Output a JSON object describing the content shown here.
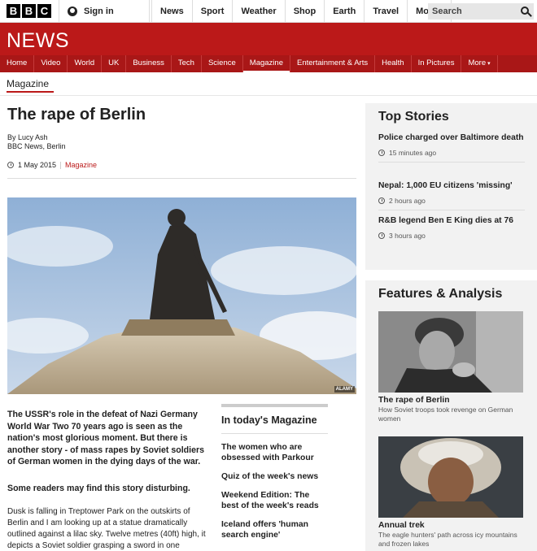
{
  "topbar": {
    "logo_letters": [
      "B",
      "B",
      "C"
    ],
    "signin_label": "Sign in",
    "nav": [
      "News",
      "Sport",
      "Weather",
      "Shop",
      "Earth",
      "Travel"
    ],
    "more_label": "More",
    "search_placeholder": "Search"
  },
  "banner": {
    "title": "NEWS"
  },
  "section_nav": {
    "items": [
      "Home",
      "Video",
      "World",
      "UK",
      "Business",
      "Tech",
      "Science",
      "Magazine",
      "Entertainment & Arts",
      "Health",
      "In Pictures"
    ],
    "more_label": "More",
    "active": "Magazine"
  },
  "section_label": "Magazine",
  "article": {
    "headline": "The rape of Berlin",
    "author": "By Lucy Ash",
    "location": "BBC News, Berlin",
    "date": "1 May 2015",
    "category": "Magazine",
    "image_credit": "ALAMY",
    "lede": "The USSR's role in the defeat of Nazi Germany World War Two 70 years ago is seen as the nation's most glorious moment. But there is another story - of mass rapes by Soviet soldiers of German women in the dying days of the war.",
    "warning": "Some readers may find this story disturbing.",
    "body": "Dusk is falling in Treptower Park on the outskirts of Berlin and I am looking up at a statue dramatically outlined against a lilac sky. Twelve metres (40ft) high, it depicts a Soviet soldier grasping a sword in one"
  },
  "todays_magazine": {
    "title": "In today's Magazine",
    "items": [
      "The women who are obsessed with Parkour",
      "Quiz of the week's news",
      "Weekend Edition: The best of the week's reads",
      "Iceland offers 'human search engine'"
    ]
  },
  "top_stories": {
    "title": "Top Stories",
    "items": [
      {
        "title": "Police charged over Baltimore death",
        "time": "15 minutes ago"
      },
      {
        "title": "Nepal: 1,000 EU citizens 'missing'",
        "time": "2 hours ago"
      },
      {
        "title": "R&B legend Ben E King dies at 76",
        "time": "3 hours ago"
      }
    ]
  },
  "features": {
    "title": "Features & Analysis",
    "items": [
      {
        "title": "The rape of Berlin",
        "summary": "How Soviet troops took revenge on German women"
      },
      {
        "title": "Annual trek",
        "summary": "The eagle hunters' path across icy mountains and frozen lakes"
      }
    ]
  },
  "colors": {
    "brand_red": "#bb1919",
    "nav_red": "#a91717",
    "sidebar_bg": "#f2f2f2"
  }
}
